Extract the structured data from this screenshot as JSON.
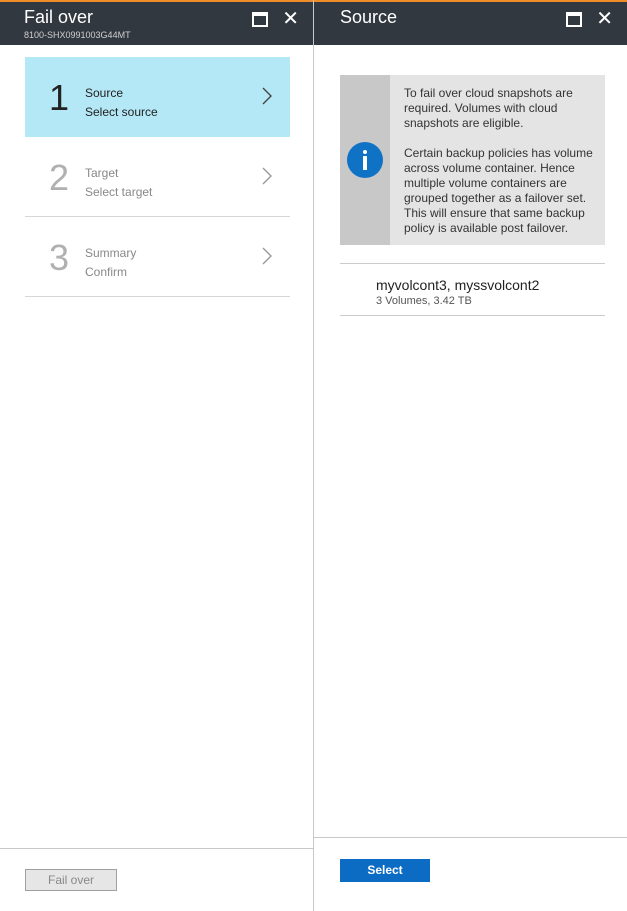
{
  "left_blade": {
    "title": "Fail over",
    "subtitle": "8100-SHX0991003G44MT",
    "steps": [
      {
        "number": "1",
        "label": "Source",
        "sub": "Select source",
        "active": true
      },
      {
        "number": "2",
        "label": "Target",
        "sub": "Select target",
        "active": false
      },
      {
        "number": "3",
        "label": "Summary",
        "sub": "Confirm",
        "active": false
      }
    ],
    "footer_button": "Fail over"
  },
  "right_blade": {
    "title": "Source",
    "info": {
      "paragraph1": "To fail over cloud snapshots are required. Volumes with cloud snapshots are eligible.",
      "paragraph2": "Certain backup policies has volume across volume container. Hence multiple volume containers are grouped together as a failover set. This will ensure that same backup policy is available post failover."
    },
    "items": [
      {
        "name": "myvolcont3, myssvolcont2",
        "meta": "3 Volumes, 3.42 TB"
      }
    ],
    "footer_button": "Select"
  },
  "colors": {
    "header_bg": "#32383f",
    "active_step": "#b4e8f6",
    "accent_blue": "#0c6cc4",
    "header_accent": "#f08c28"
  }
}
